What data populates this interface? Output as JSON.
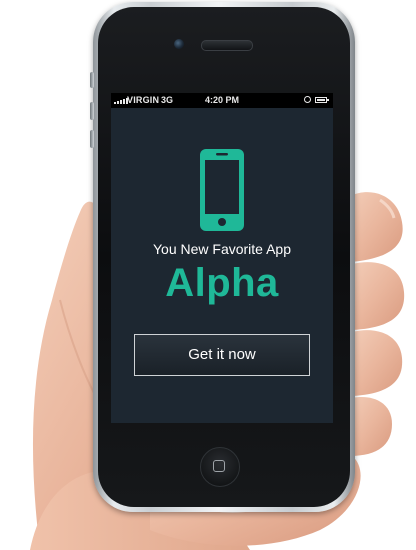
{
  "status_bar": {
    "carrier": "VIRGIN",
    "network": "3G",
    "time": "4:20 PM"
  },
  "screen": {
    "app_icon": "smartphone-icon",
    "tagline": "You New Favorite App",
    "app_name": "Alpha",
    "cta_label": "Get it now"
  },
  "colors": {
    "accent": "#1fb898",
    "screen_background": "#1d2731",
    "text": "#ffffff"
  }
}
